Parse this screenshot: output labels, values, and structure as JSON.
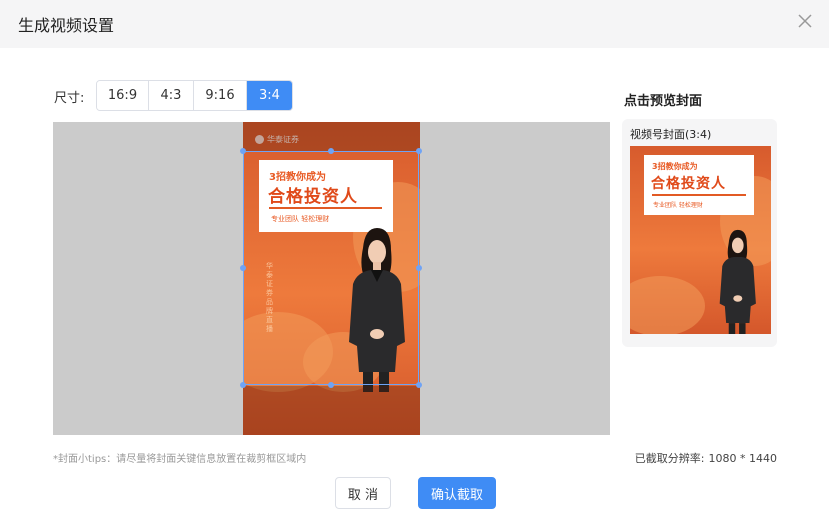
{
  "dialog": {
    "title": "生成视频设置",
    "close_icon": "close-icon"
  },
  "size": {
    "label": "尺寸:",
    "options": [
      {
        "label": "16:9",
        "active": false
      },
      {
        "label": "4:3",
        "active": false
      },
      {
        "label": "9:16",
        "active": false
      },
      {
        "label": "3:4",
        "active": true
      }
    ],
    "active_color": "#3f8cf5"
  },
  "poster": {
    "brand": "华泰证券",
    "headline_small": "3招教你成为",
    "headline_big": "合格投资人",
    "tagline": "专业团队 轻松理财",
    "vertical_text": "华泰证券品牌直播",
    "theme_color": "#ee7a3c"
  },
  "preview": {
    "title": "点击预览封面",
    "subtitle": "视频号封面(3:4)"
  },
  "footer": {
    "tips": "*封面小tips：请尽量将封面关键信息放置在裁剪框区域内",
    "resolution_label": "已截取分辨率:",
    "resolution_value": "1080 * 1440",
    "cancel_label": "取 消",
    "confirm_label": "确认截取"
  }
}
